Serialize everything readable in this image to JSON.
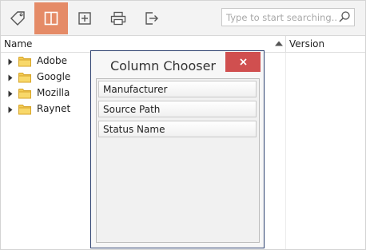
{
  "toolbar": {
    "buttons": [
      {
        "icon": "tag-icon",
        "active": false
      },
      {
        "icon": "columns-icon",
        "active": true
      },
      {
        "icon": "add-box-icon",
        "active": false
      },
      {
        "icon": "print-icon",
        "active": false
      },
      {
        "icon": "export-icon",
        "active": false
      }
    ],
    "active_color": "#e58b67"
  },
  "search": {
    "placeholder": "Type to start searching...",
    "value": ""
  },
  "grid": {
    "columns": [
      {
        "label": "Name",
        "sorted": "ascending"
      },
      {
        "label": "Version"
      }
    ],
    "rows": [
      {
        "label": "Adobe",
        "type": "folder"
      },
      {
        "label": "Google",
        "type": "folder"
      },
      {
        "label": "Mozilla",
        "type": "folder"
      },
      {
        "label": "Raynet",
        "type": "folder"
      }
    ]
  },
  "column_chooser": {
    "title": "Column Chooser",
    "close_color": "#d04f4f",
    "items": [
      "Manufacturer",
      "Source Path",
      "Status Name"
    ]
  }
}
